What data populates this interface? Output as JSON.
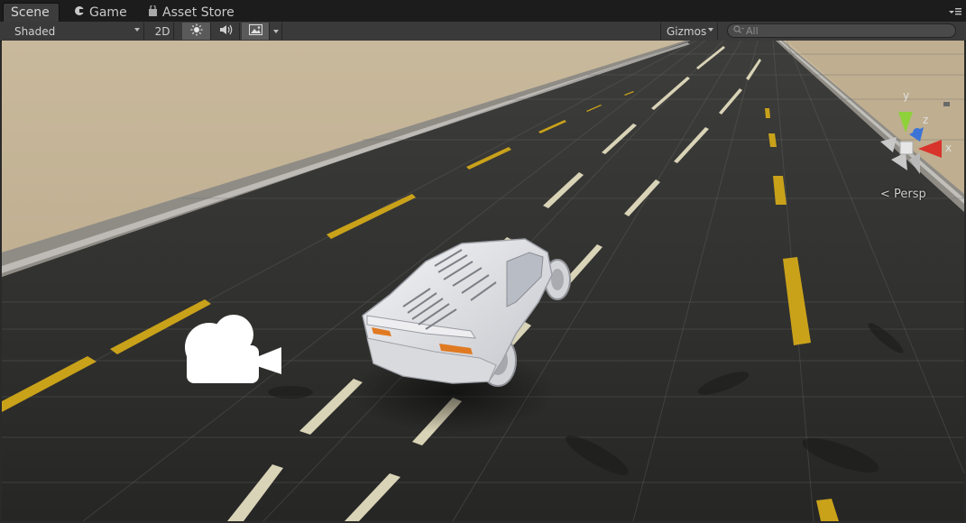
{
  "tabs": [
    {
      "label": "Scene",
      "icon": "scene-icon",
      "active": true
    },
    {
      "label": "Game",
      "icon": "game-controller-icon",
      "active": false
    },
    {
      "label": "Asset Store",
      "icon": "shopping-bag-icon",
      "active": false
    }
  ],
  "toolbar": {
    "draw_mode": "Shaded",
    "mode_2d": "2D",
    "lighting_icon": "sun-icon",
    "audio_icon": "speaker-icon",
    "effects_icon": "image-icon",
    "gizmos_label": "Gizmos",
    "search_placeholder": "All"
  },
  "gizmo": {
    "y_label": "y",
    "z_label": "z",
    "x_label": "x",
    "projection": "< Persp",
    "colors": {
      "y": "#8fd13b",
      "z": "#3b74d6",
      "x": "#d8342b"
    }
  },
  "scene": {
    "camera_icon": "camera-icon",
    "object": "white sports car on asphalt road"
  }
}
